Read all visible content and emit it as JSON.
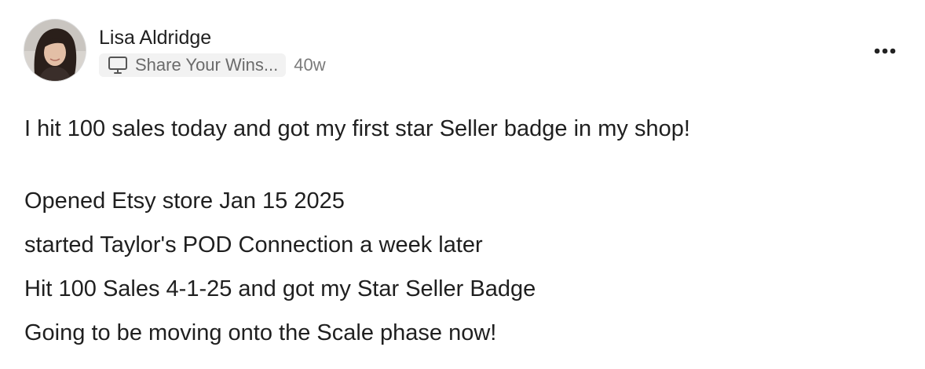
{
  "post": {
    "author": "Lisa Aldridge",
    "group": "Share Your Wins...",
    "time": "40w",
    "icons": {
      "group_icon": "monitor-icon",
      "menu_icon": "more-horizontal-icon"
    },
    "body": {
      "first_paragraph": "I hit 100 sales today and got my first star Seller badge in my shop!",
      "lines": [
        "Opened Etsy store Jan 15 2025",
        "started Taylor's POD Connection a week later",
        "Hit 100 Sales 4-1-25 and got my Star Seller Badge",
        "Going to be moving onto the Scale phase now!"
      ]
    }
  }
}
